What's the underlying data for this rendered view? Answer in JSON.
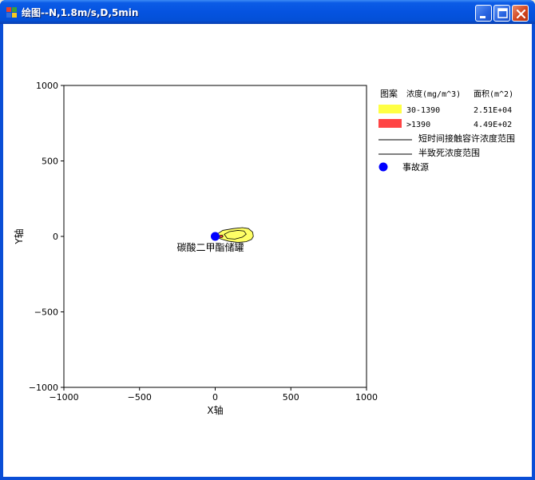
{
  "window": {
    "title": "绘图--N,1.8m/s,D,5min",
    "controls": [
      "minimize",
      "maximize",
      "close"
    ]
  },
  "chart_data": {
    "type": "scatter",
    "xlabel": "X轴",
    "ylabel": "Y轴",
    "xlim": [
      -1000,
      1000
    ],
    "ylim": [
      -1000,
      1000
    ],
    "xticks": [
      -1000,
      -500,
      0,
      500,
      1000
    ],
    "yticks": [
      -1000,
      -500,
      0,
      500,
      1000
    ],
    "xtick_labels": [
      "−1000",
      "−500",
      "0",
      "500",
      "1000"
    ],
    "ytick_labels": [
      "−1000",
      "−500",
      "0",
      "500",
      "1000"
    ],
    "grid": false,
    "source": {
      "x": 0,
      "y": 0,
      "label": "碳酸二甲酯储罐",
      "color": "#0000ff"
    },
    "zones": [
      {
        "name": "30-1390",
        "area": "2.51E+04",
        "color": "#ffff66",
        "outline": [
          [
            0,
            5
          ],
          [
            20,
            20
          ],
          [
            50,
            40
          ],
          [
            120,
            52
          ],
          [
            180,
            58
          ],
          [
            220,
            52
          ],
          [
            248,
            28
          ],
          [
            252,
            0
          ],
          [
            240,
            -20
          ],
          [
            205,
            -35
          ],
          [
            150,
            -40
          ],
          [
            90,
            -32
          ],
          [
            40,
            -18
          ],
          [
            10,
            -6
          ]
        ]
      },
      {
        "name": ">1390",
        "area": "4.49E+02",
        "color": "#ff4444",
        "outline": [
          [
            25,
            0
          ],
          [
            35,
            8
          ],
          [
            48,
            8
          ],
          [
            52,
            0
          ],
          [
            45,
            -7
          ],
          [
            32,
            -7
          ]
        ]
      }
    ],
    "short_term_contour": [
      [
        60,
        14
      ],
      [
        95,
        32
      ],
      [
        150,
        40
      ],
      [
        190,
        36
      ],
      [
        205,
        15
      ],
      [
        180,
        -5
      ],
      [
        130,
        -18
      ],
      [
        80,
        -14
      ]
    ],
    "legend": {
      "position": "right",
      "headers": [
        "图案",
        "浓度(mg/m^3)",
        "面积(m^2)"
      ],
      "rows": [
        {
          "swatch": "#ffff44",
          "range": "30-1390",
          "area": "2.51E+04"
        },
        {
          "swatch": "#ff4444",
          "range": ">1390",
          "area": "4.49E+02"
        }
      ],
      "lines": [
        "短时间接触容许浓度范围",
        "半致死浓度范围"
      ],
      "source_label": "事故源"
    }
  }
}
